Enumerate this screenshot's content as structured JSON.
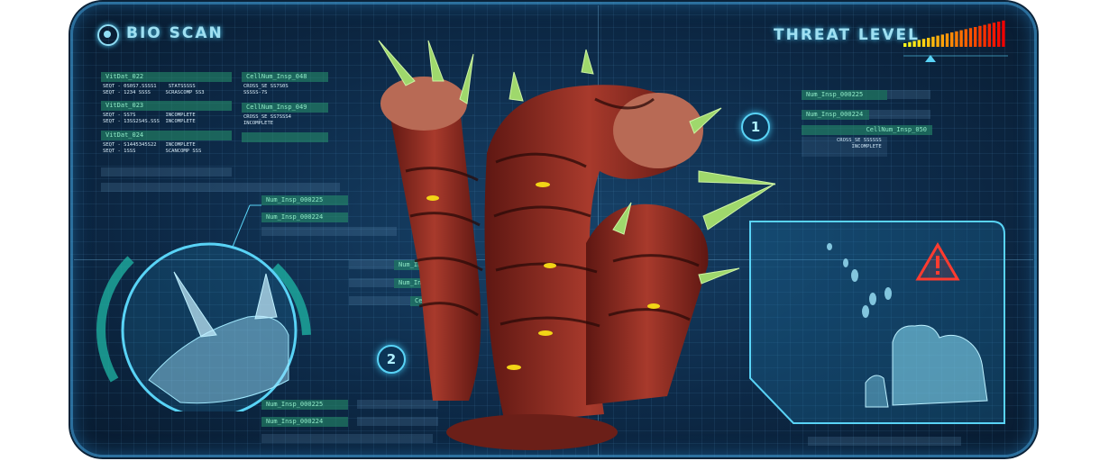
{
  "header": {
    "bio_scan": "BIO SCAN",
    "threat_level": "THREAT LEVEL"
  },
  "threat_meter": {
    "level": 1.0
  },
  "left_data": {
    "vitdat_1": "VitDat_022",
    "vitdat_1_lines": "SEQT - 0S0S7.SSSS1    STATSSSSS\nSEQT - 1234 SSSS     SCRASCOMP SS3",
    "vitdat_2": "VitDat_023",
    "vitdat_2_lines": "SEQT - SS7S          INCOMPLETE\nSEQT - 13SS2S4S.SSS  INCOMPLETE",
    "vitdat_3": "VitDat_024",
    "vitdat_3_lines": "SEQT - S1445345S22   INCOMPLETE\nSEQT - 1SSS          SCANCOMP SSS",
    "cellnum_1": "CellNum_Insp_048",
    "cellnum_1_lines": "CROSS_SE SS7S0S\nSSSSS-7S",
    "cellnum_2": "CellNum_Insp_049",
    "cellnum_2_lines": "CROSS_SE SS7SSS4\nINCOMPLETE"
  },
  "left_tags": {
    "tag_a": "Num_Insp_000225",
    "tag_b": "Num_Insp_000224"
  },
  "center_tags": {
    "tag_a": "Num_Insp",
    "tag_b": "Num_Insp",
    "tag_c": "Cell"
  },
  "bottom_tags": {
    "tag_a": "Num_Insp_000225",
    "tag_b": "Num_Insp_000224"
  },
  "right_tags": {
    "tag_a": "Num_Insp_000225",
    "tag_b": "Num_Insp_000224",
    "tag_c": "CellNum_Insp_050",
    "tag_c_lines": "CROSS_SE SSSSSS\nINCOMPLETE"
  },
  "markers": {
    "one": "1",
    "two": "2"
  },
  "colors": {
    "accent": "#59d3f6",
    "warning": "#ff3b2f",
    "creature": "#8a2a22"
  }
}
